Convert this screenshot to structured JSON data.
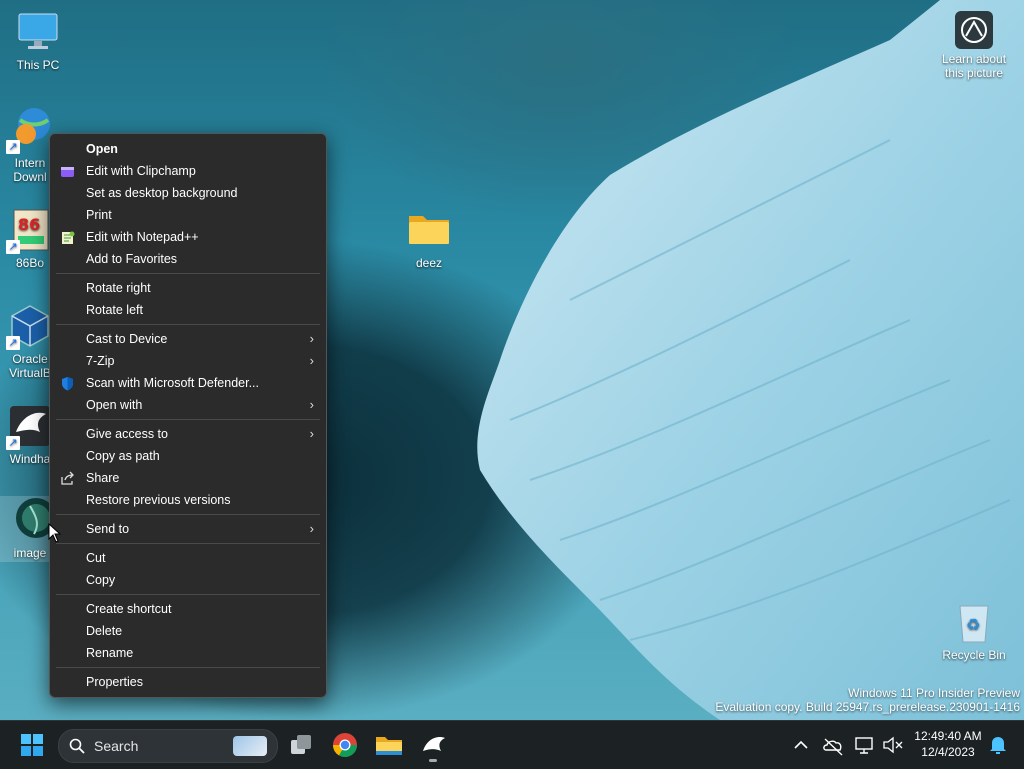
{
  "desktop": {
    "icons": {
      "this_pc": "This PC",
      "internet_download": "Intern\nDownl",
      "box86": "86Bo",
      "oracle_vbox": "Oracle\nVirtualB",
      "windhawk": "Windha",
      "image": "image",
      "deez": "deez",
      "recycle_bin": "Recycle Bin",
      "learn_picture": "Learn about\nthis picture"
    }
  },
  "context_menu": {
    "open": "Open",
    "edit_clipchamp": "Edit with Clipchamp",
    "set_background": "Set as desktop background",
    "print": "Print",
    "edit_notepad": "Edit with Notepad++",
    "add_favorites": "Add to Favorites",
    "rotate_right": "Rotate right",
    "rotate_left": "Rotate left",
    "cast_device": "Cast to Device",
    "seven_zip": "7-Zip",
    "scan_defender": "Scan with Microsoft Defender...",
    "open_with": "Open with",
    "give_access": "Give access to",
    "copy_path": "Copy as path",
    "share": "Share",
    "restore_versions": "Restore previous versions",
    "send_to": "Send to",
    "cut": "Cut",
    "copy": "Copy",
    "create_shortcut": "Create shortcut",
    "delete": "Delete",
    "rename": "Rename",
    "properties": "Properties",
    "submenu_arrow": "›"
  },
  "watermark": {
    "line1": "Windows 11 Pro Insider Preview",
    "line2": "Evaluation copy. Build 25947.rs_prerelease.230901-1416"
  },
  "taskbar": {
    "search_label": "Search",
    "time": "12:49:40 AM",
    "date": "12/4/2023"
  },
  "colors": {
    "menu_bg": "#2b2b2b",
    "taskbar_bg": "#1c2124",
    "accent": "#0078d4"
  }
}
